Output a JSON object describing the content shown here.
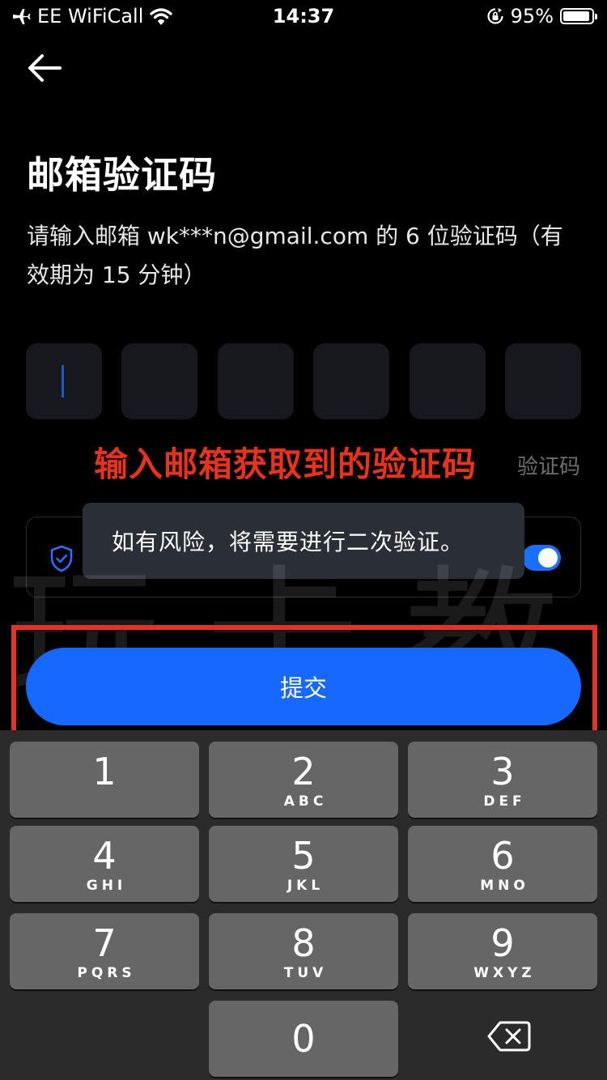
{
  "status_bar": {
    "carrier": "EE WiFiCall",
    "time": "14:37",
    "battery": "95%",
    "battery_level": 0.95
  },
  "page": {
    "title": "邮箱验证码",
    "instruction": "请输入邮箱 wk***n@gmail.com 的 6 位验证码（有效期为 15 分钟）",
    "resend_label": "验证码",
    "code_digits": [
      "",
      "",
      "",
      "",
      "",
      ""
    ]
  },
  "annotation": {
    "text": "输入邮箱获取到的验证码",
    "color": "#e8321c"
  },
  "toast": {
    "message": "如有风险，将需要进行二次验证。"
  },
  "security_toggle": {
    "on": true
  },
  "watermark": {
    "text": "玩卡教授"
  },
  "submit_button": {
    "label": "提交",
    "color": "#1668ff"
  },
  "keyboard": {
    "keys": [
      {
        "num": "1",
        "letters": ""
      },
      {
        "num": "2",
        "letters": "ABC"
      },
      {
        "num": "3",
        "letters": "DEF"
      },
      {
        "num": "4",
        "letters": "GHI"
      },
      {
        "num": "5",
        "letters": "JKL"
      },
      {
        "num": "6",
        "letters": "MNO"
      },
      {
        "num": "7",
        "letters": "PQRS"
      },
      {
        "num": "8",
        "letters": "TUV"
      },
      {
        "num": "9",
        "letters": "WXYZ"
      },
      {
        "num": "0",
        "letters": ""
      }
    ],
    "delete_icon": "backspace-icon"
  }
}
